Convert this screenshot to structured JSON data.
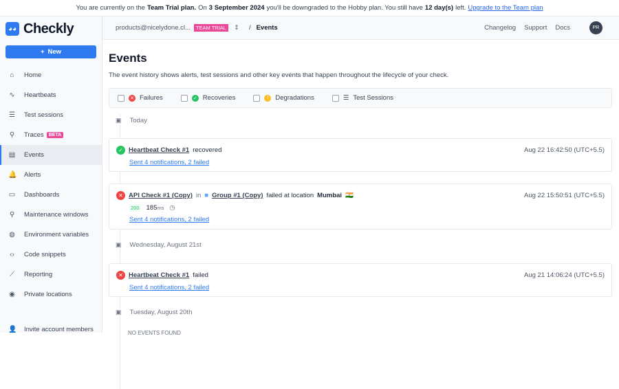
{
  "banner": {
    "t1": "You are currently on the",
    "b1": "Team Trial plan.",
    "t2": "On",
    "b2": "3 September 2024",
    "t3": "you'll be downgraded to the Hobby plan. You still have",
    "b3": "12 day(s)",
    "t4": "left.",
    "link": "Upgrade to the Team plan"
  },
  "sidebar": {
    "logo": "Checkly",
    "new_label": "New",
    "items": [
      {
        "label": "Home",
        "icon": "⌂"
      },
      {
        "label": "Heartbeats",
        "icon": "∿"
      },
      {
        "label": "Test sessions",
        "icon": "☰"
      },
      {
        "label": "Traces",
        "icon": "⚲",
        "badge": "BETA"
      },
      {
        "label": "Events",
        "icon": "▤"
      },
      {
        "label": "Alerts",
        "icon": "🔔"
      },
      {
        "label": "Dashboards",
        "icon": "▭"
      },
      {
        "label": "Maintenance windows",
        "icon": "⚲"
      },
      {
        "label": "Environment variables",
        "icon": "◍"
      },
      {
        "label": "Code snippets",
        "icon": "‹›"
      },
      {
        "label": "Reporting",
        "icon": "⟋"
      },
      {
        "label": "Private locations",
        "icon": "◉"
      }
    ],
    "invite": "Invite account members"
  },
  "topbar": {
    "account": "products@nicelydone.cl...",
    "plan_badge": "TEAM TRIAL",
    "breadcrumb": "Events",
    "links": [
      "Changelog",
      "Support",
      "Docs"
    ],
    "avatar": "PR"
  },
  "main": {
    "title": "Events",
    "description": "The event history shows alerts, test sessions and other key events that happen throughout the lifecycle of your check.",
    "filters": [
      "Failures",
      "Recoveries",
      "Degradations",
      "Test Sessions"
    ],
    "dates": [
      "Today",
      "Wednesday, August 21st",
      "Tuesday, August 20th"
    ],
    "events": [
      {
        "check": "Heartbeat Check #1",
        "text": "recovered",
        "time": "Aug 22 16:42:50 (UTC+5.5)",
        "notif": "Sent 4 notifications, 2 failed"
      },
      {
        "check": "API Check #1 (Copy)",
        "in": "in",
        "group": "Group #1 (Copy)",
        "text": "failed at location",
        "location": "Mumbai",
        "flag": "🇮🇳",
        "status": "200",
        "ms": "185",
        "unit": "ms",
        "time": "Aug 22 15:50:51 (UTC+5.5)",
        "notif": "Sent 4 notifications, 2 failed"
      },
      {
        "check": "Heartbeat Check #1",
        "text": "failed",
        "time": "Aug 21 14:06:24 (UTC+5.5)",
        "notif": "Sent 4 notifications, 2 failed"
      }
    ],
    "empty": "NO EVENTS FOUND"
  },
  "colors": {
    "accent": "#2f7af0",
    "pink": "#ec4899",
    "red": "#ef4444",
    "green": "#22c55e",
    "yellow": "#fbbf24"
  }
}
